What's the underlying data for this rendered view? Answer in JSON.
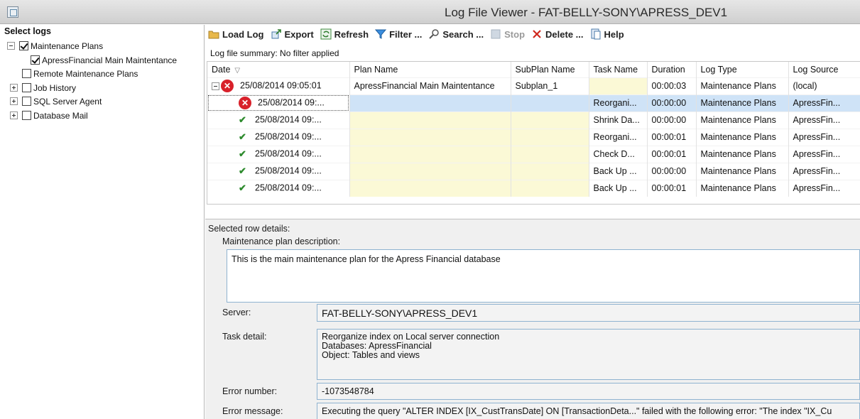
{
  "window": {
    "title": "Log File Viewer - FAT-BELLY-SONY\\APRESS_DEV1"
  },
  "left_pane": {
    "header": "Select logs",
    "tree": [
      {
        "label": "Maintenance Plans",
        "checked": true,
        "expander": "minus"
      },
      {
        "label": "ApressFinancial Main Maintentance",
        "checked": true
      },
      {
        "label": "Remote Maintenance Plans",
        "checked": false
      },
      {
        "label": "Job History",
        "checked": false,
        "expander": "plus"
      },
      {
        "label": "SQL Server Agent",
        "checked": false,
        "expander": "plus"
      },
      {
        "label": "Database Mail",
        "checked": false,
        "expander": "plus"
      }
    ]
  },
  "toolbar": {
    "load_log": "Load Log",
    "export": "Export",
    "refresh": "Refresh",
    "filter": "Filter ...",
    "search": "Search ...",
    "stop": "Stop",
    "delete": "Delete ...",
    "help": "Help"
  },
  "summary": "Log file summary: No filter applied",
  "grid": {
    "columns": [
      "Date",
      "Plan Name",
      "SubPlan Name",
      "Task Name",
      "Duration",
      "Log Type",
      "Log Source"
    ],
    "rows": [
      {
        "status": "error",
        "date": "25/08/2014 09:05:01",
        "plan": "ApressFinancial Main Maintentance",
        "subplan": "Subplan_1",
        "task": "",
        "duration": "00:00:03",
        "log_type": "Maintenance Plans",
        "log_source": "(local)"
      },
      {
        "status": "error",
        "date": "25/08/2014 09:...",
        "plan": "",
        "subplan": "",
        "task": "Reorgani...",
        "duration": "00:00:00",
        "log_type": "Maintenance Plans",
        "log_source": "ApressFin..."
      },
      {
        "status": "ok",
        "date": "25/08/2014 09:...",
        "plan": "",
        "subplan": "",
        "task": "Shrink Da...",
        "duration": "00:00:00",
        "log_type": "Maintenance Plans",
        "log_source": "ApressFin..."
      },
      {
        "status": "ok",
        "date": "25/08/2014 09:...",
        "plan": "",
        "subplan": "",
        "task": "Reorgani...",
        "duration": "00:00:01",
        "log_type": "Maintenance Plans",
        "log_source": "ApressFin..."
      },
      {
        "status": "ok",
        "date": "25/08/2014 09:...",
        "plan": "",
        "subplan": "",
        "task": "Check D...",
        "duration": "00:00:01",
        "log_type": "Maintenance Plans",
        "log_source": "ApressFin..."
      },
      {
        "status": "ok",
        "date": "25/08/2014 09:...",
        "plan": "",
        "subplan": "",
        "task": "Back Up ...",
        "duration": "00:00:00",
        "log_type": "Maintenance Plans",
        "log_source": "ApressFin..."
      },
      {
        "status": "ok",
        "date": "25/08/2014 09:...",
        "plan": "",
        "subplan": "",
        "task": "Back Up ...",
        "duration": "00:00:01",
        "log_type": "Maintenance Plans",
        "log_source": "ApressFin..."
      }
    ]
  },
  "details": {
    "title": "Selected row details:",
    "desc_label": "Maintenance plan description:",
    "desc_value": "This is the main maintenance plan for the Apress Financial database",
    "server_label": "Server:",
    "server_value": "FAT-BELLY-SONY\\APRESS_DEV1",
    "task_label": "Task detail:",
    "task_lines": [
      "Reorganize index on Local server connection",
      "Databases: ApressFinancial",
      "Object: Tables and views"
    ],
    "error_number_label": "Error number:",
    "error_number_value": "-1073548784",
    "error_message_label": "Error message:",
    "error_message_value": "Executing the query \"ALTER INDEX [IX_CustTransDate] ON [TransactionDeta...\" failed with the following error: \"The index \"IX_Cu"
  }
}
